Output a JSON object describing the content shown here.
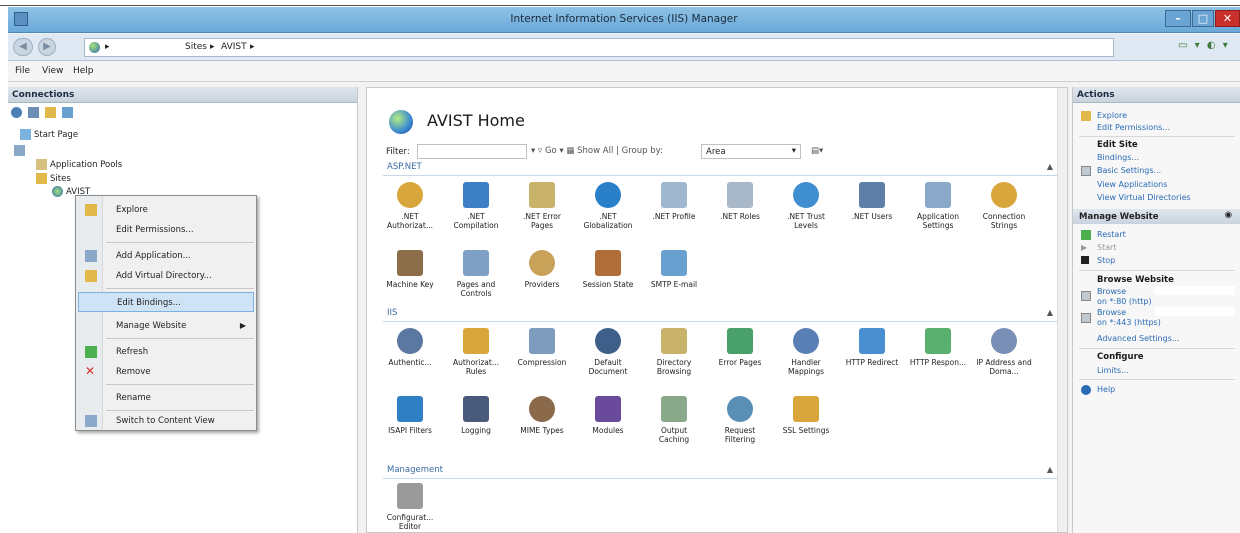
{
  "window": {
    "title": "Internet Information Services (IIS) Manager"
  },
  "address": {
    "crumbs": [
      "Sites",
      "AVIST"
    ],
    "sep": "▸"
  },
  "menubar": {
    "items": [
      "File",
      "View",
      "Help"
    ]
  },
  "connections": {
    "header": "Connections",
    "tree": {
      "start_page": "Start Page",
      "app_pools": "Application Pools",
      "sites": "Sites",
      "site": "AVIST"
    }
  },
  "context_menu": {
    "items": [
      "Explore",
      "Edit Permissions...",
      "Add Application...",
      "Add Virtual Directory...",
      "Edit Bindings...",
      "Manage Website",
      "Refresh",
      "Remove",
      "Rename",
      "Switch to Content View"
    ]
  },
  "center": {
    "title": "AVIST Home",
    "filter": {
      "label": "Filter:",
      "go": "Go",
      "show_all": "Show All",
      "group_by": "Group by:",
      "group_value": "Area"
    },
    "sections": [
      "ASP.NET",
      "IIS",
      "Management"
    ],
    "aspnet": [
      ".NET Authorizat...",
      ".NET Compilation",
      ".NET Error Pages",
      ".NET Globalization",
      ".NET Profile",
      ".NET Roles",
      ".NET Trust Levels",
      ".NET Users",
      "Application Settings",
      "Connection Strings",
      "Machine Key",
      "Pages and Controls",
      "Providers",
      "Session State",
      "SMTP E-mail"
    ],
    "iis": [
      "Authentic...",
      "Authorizat... Rules",
      "Compression",
      "Default Document",
      "Directory Browsing",
      "Error Pages",
      "Handler Mappings",
      "HTTP Redirect",
      "HTTP Respon...",
      "IP Address and Doma...",
      "ISAPI Filters",
      "Logging",
      "MIME Types",
      "Modules",
      "Output Caching",
      "Request Filtering",
      "SSL Settings"
    ],
    "management": [
      "Configurat... Editor"
    ]
  },
  "actions": {
    "header": "Actions",
    "explore": "Explore",
    "edit_permissions": "Edit Permissions...",
    "edit_site": "Edit Site",
    "bindings": "Bindings...",
    "basic_settings": "Basic Settings...",
    "view_applications": "View Applications",
    "view_vdirs": "View Virtual Directories",
    "manage_website": "Manage Website",
    "restart": "Restart",
    "start": "Start",
    "stop": "Stop",
    "browse_website": "Browse Website",
    "browse1_a": "Browse",
    "browse1_b": "on *:80 (http)",
    "browse2_a": "Browse",
    "browse2_b": "on *:443 (https)",
    "advanced_settings": "Advanced Settings...",
    "configure": "Configure",
    "limits": "Limits...",
    "help": "Help"
  }
}
